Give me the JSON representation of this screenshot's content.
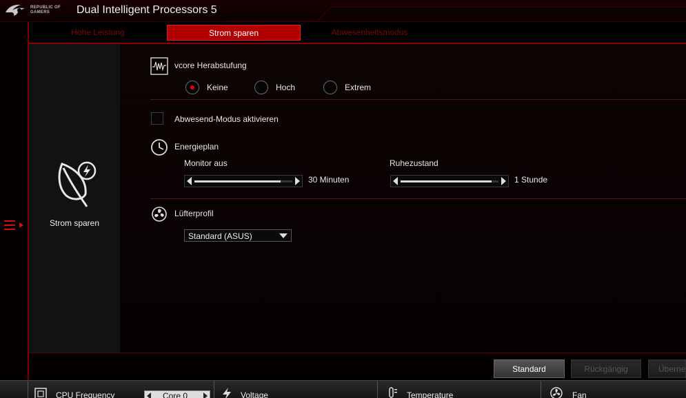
{
  "app": {
    "title": "Dual Intelligent Processors 5",
    "logo_text_line1": "REPUBLIC OF",
    "logo_text_line2": "GAMERS",
    "accent_color": "#b00000"
  },
  "tabs": [
    {
      "label": "Hohe Leistung",
      "active": false
    },
    {
      "label": "Strom sparen",
      "active": true
    },
    {
      "label": "Abwesenheitsmodus",
      "active": false
    }
  ],
  "side_panel": {
    "icon": "leaf-lightning-icon",
    "label": "Strom sparen"
  },
  "vcore": {
    "icon": "waveform-icon",
    "title": "vcore Herabstufung",
    "options": [
      {
        "label": "Keine",
        "checked": true
      },
      {
        "label": "Hoch",
        "checked": false
      },
      {
        "label": "Extrem",
        "checked": false
      }
    ]
  },
  "away_mode": {
    "label": "Abwesend-Modus aktivieren",
    "checked": false
  },
  "power_plan": {
    "icon": "clock-icon",
    "title": "Energieplan",
    "monitor": {
      "label": "Monitor aus",
      "value": "30 Minuten",
      "level": 0.88
    },
    "sleep": {
      "label": "Ruhezustand",
      "value": "1 Stunde",
      "level": 0.93
    }
  },
  "fan_profile": {
    "icon": "fan-icon",
    "title": "Lüfterprofil",
    "selected": "Standard (ASUS)"
  },
  "buttons": {
    "standard": "Standard",
    "undo": "Rückgängig",
    "apply": "Überne"
  },
  "statusbar": {
    "cpu_frequency": "CPU Frequency",
    "core_value": "Core 0",
    "voltage": "Voltage",
    "temperature": "Temperature",
    "fan": "Fan"
  }
}
